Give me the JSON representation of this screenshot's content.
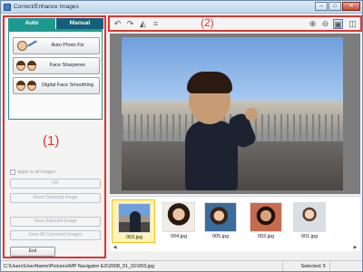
{
  "window": {
    "title": "Correct/Enhance Images"
  },
  "tabs": [
    {
      "label": "Auto"
    },
    {
      "label": "Manual"
    }
  ],
  "auto_tools": [
    {
      "label": "Auto Photo Fix"
    },
    {
      "label": "Face Sharpener"
    },
    {
      "label": "Digital Face Smoothing"
    }
  ],
  "callouts": {
    "left": "(1)",
    "toolbar": "(2)"
  },
  "options": {
    "apply_all_label": "Apply to all images",
    "apply_all_checked": false
  },
  "buttons": {
    "ok": "OK",
    "reset_selected": "Reset Selected Image",
    "save_selected": "Save Selected Image",
    "save_all": "Save All Corrected Images",
    "exit": "Exit"
  },
  "toolbar_icons": [
    "rotate-left-icon",
    "rotate-right-icon",
    "invert-icon",
    "trim-icon",
    "zoom-in-icon",
    "zoom-out-icon",
    "whole-image-view-icon",
    "compare-view-icon"
  ],
  "thumbnails": [
    {
      "label": "003.jpg",
      "selected": true
    },
    {
      "label": "004.jpg",
      "selected": false
    },
    {
      "label": "005.jpg",
      "selected": false
    },
    {
      "label": "002.jpg",
      "selected": false
    },
    {
      "label": "001.jpg",
      "selected": false
    }
  ],
  "status": {
    "path": "C:\\Users\\UserName\\Pictures\\MP Navigator EX\\2008_01_01\\003.jpg",
    "selected": "Selected: 5"
  },
  "colors": {
    "callout": "#e5312b",
    "tab_auto": "#1d9a8f",
    "tab_manual": "#125f79",
    "selection": "#f0c419"
  }
}
